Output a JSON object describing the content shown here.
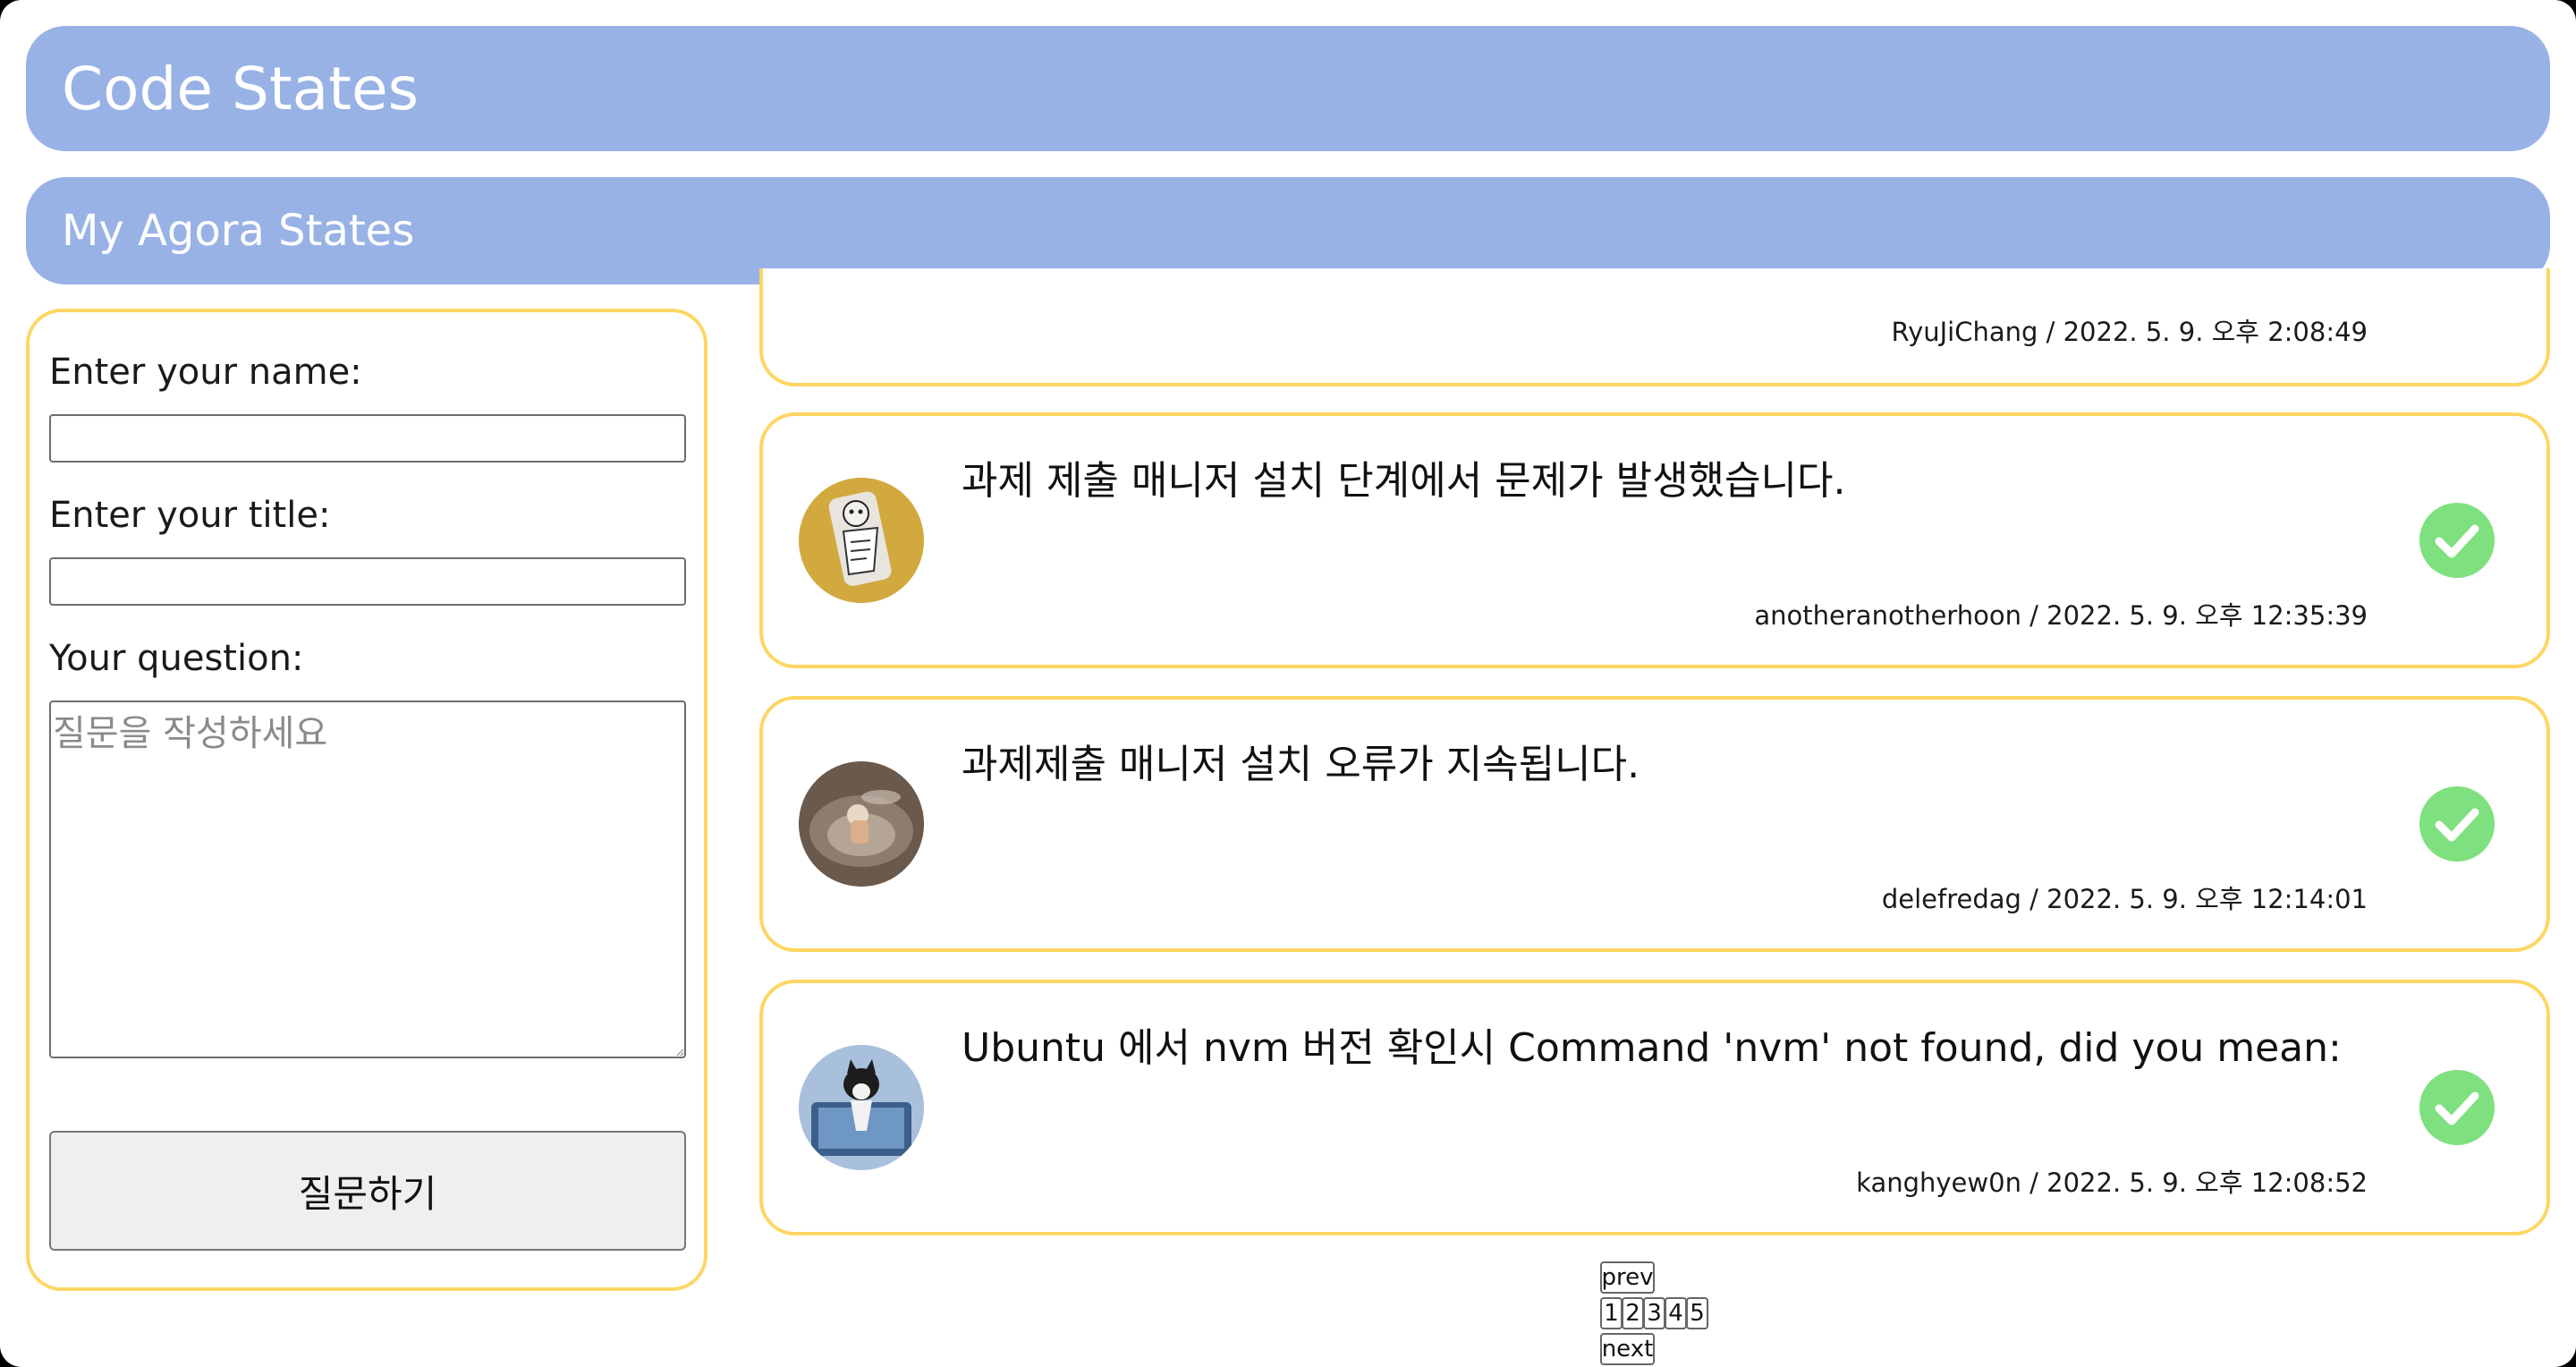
{
  "header": {
    "title": "Code States",
    "subtitle": "My Agora States"
  },
  "form": {
    "name_label": "Enter your name:",
    "name_value": "",
    "title_label": "Enter your title:",
    "title_value": "",
    "question_label": "Your question:",
    "question_placeholder": "질문을 작성하세요",
    "submit_label": "질문하기"
  },
  "discussions": [
    {
      "title": "",
      "author": "RyuJiChang",
      "created_at": "2022. 5. 9. 오후 2:08:49",
      "meta": "RyuJiChang / 2022. 5. 9. 오후 2:08:49",
      "answered": false,
      "avatar_icon": "user-avatar-icon"
    },
    {
      "title": "과제 제출 매니저 설치 단계에서 문제가 발생했습니다.",
      "author": "anotheranotherhoon",
      "created_at": "2022. 5. 9. 오후 12:35:39",
      "meta": "anotheranotherhoon / 2022. 5. 9. 오후 12:35:39",
      "answered": true,
      "avatar_icon": "user-avatar-icon"
    },
    {
      "title": "과제제출 매니저 설치 오류가 지속됩니다.",
      "author": "delefredag",
      "created_at": "2022. 5. 9. 오후 12:14:01",
      "meta": "delefredag / 2022. 5. 9. 오후 12:14:01",
      "answered": true,
      "avatar_icon": "user-avatar-icon"
    },
    {
      "title": "Ubuntu 에서 nvm 버전 확인시 Command 'nvm' not found, did you mean:",
      "author": "kanghyew0n",
      "created_at": "2022. 5. 9. 오후 12:08:52",
      "meta": "kanghyew0n / 2022. 5. 9. 오후 12:08:52",
      "answered": true,
      "avatar_icon": "user-avatar-icon"
    }
  ],
  "pagination": {
    "prev_label": "prev",
    "next_label": "next",
    "pages": [
      "1",
      "2",
      "3",
      "4",
      "5"
    ]
  },
  "colors": {
    "header_bg": "#98b2e6",
    "header_text": "#ffffff",
    "card_border": "#fdd663",
    "answered_check": "#7ee07e"
  }
}
